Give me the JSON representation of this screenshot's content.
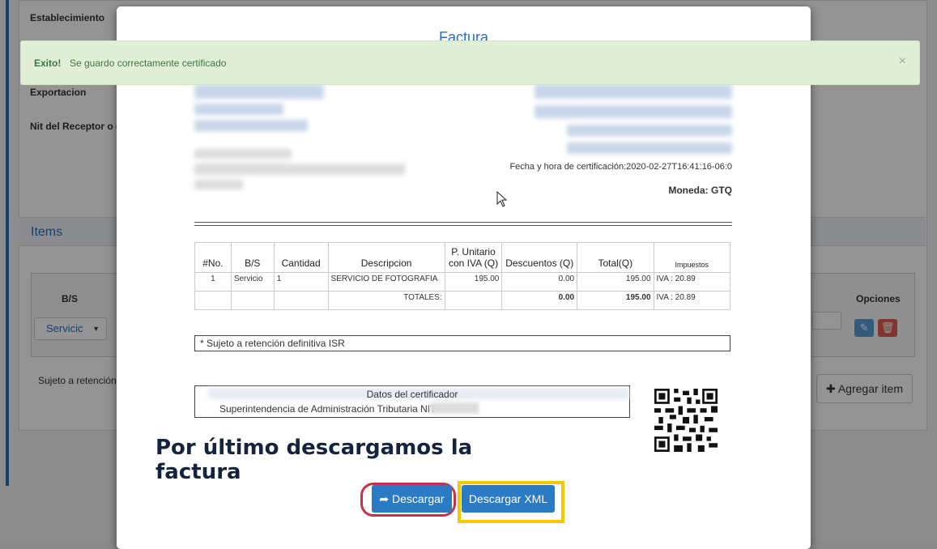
{
  "background": {
    "fields": [
      "Establecimiento",
      "Exportacion",
      "Nit del Receptor o ("
    ],
    "items_title": "Items",
    "table_headers": {
      "bs": "B/S",
      "opciones": "Opciones"
    },
    "select_value": "Servicic",
    "note": "Sujeto a retención c",
    "add_item_label": "Agregar item"
  },
  "alert": {
    "strong": "Exito!",
    "message": "Se guardo correctamente certificado",
    "close": "×"
  },
  "modal": {
    "title": "Factura",
    "invoice": {
      "cert_date": "Fecha y hora de certificación:2020-02-27T16:41:16-06:0",
      "currency": "Moneda: GTQ",
      "headers": [
        "#No.",
        "B/S",
        "Cantidad",
        "Descripcion",
        "P. Unitario con IVA (Q)",
        "Descuentos (Q)",
        "Total(Q)",
        "Impuestos"
      ],
      "row": {
        "no": "1",
        "bs": "Servicio",
        "qty": "1",
        "desc": "SERVICIO DE FOTOGRAFIA",
        "unit": "195.00",
        "disc": "0.00",
        "total": "195.00",
        "tax": "IVA : 20.89"
      },
      "totals": {
        "label": "TOTALES:",
        "disc": "0.00",
        "total": "195.00",
        "tax": "IVA : 20.89"
      },
      "isr_note": "* Sujeto a retención definitiva ISR",
      "cert_title": "Datos del certificador",
      "cert_line": "Superintendencia de Administración Tributaria NIT:"
    },
    "overlay_text_1": "Por último descargamos la",
    "overlay_text_2": "factura",
    "buttons": {
      "download": "Descargar",
      "download_xml": "Descargar XML"
    }
  }
}
